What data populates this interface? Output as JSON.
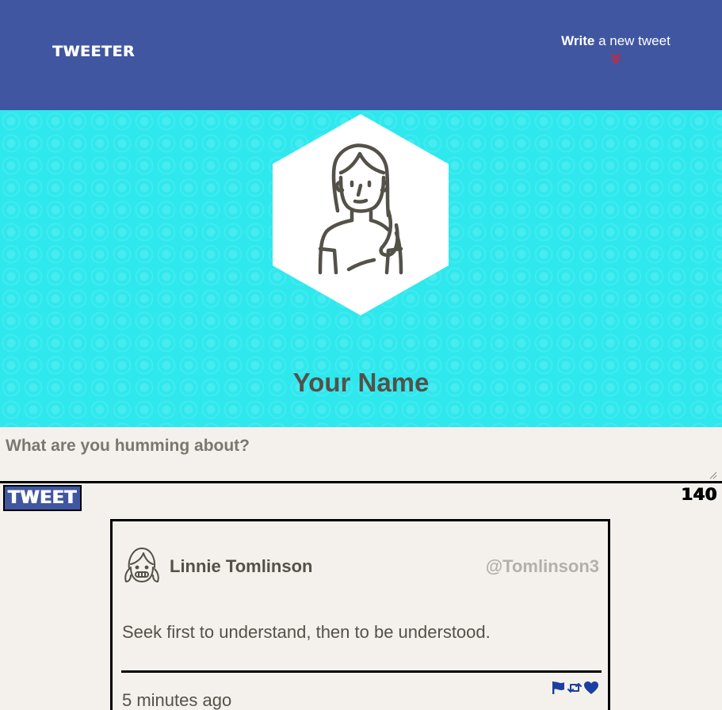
{
  "nav": {
    "brand": "TWEETER",
    "compose_bold": "Write",
    "compose_rest": " a new tweet",
    "arrow_icon": "double-chevron-down-icon",
    "arrow_color": "#e0212a"
  },
  "header": {
    "profile_name": "Your Name",
    "avatar_icon": "user-avatar-icon"
  },
  "composer": {
    "placeholder": "What are you humming about?",
    "value": "",
    "tweet_button": "TWEET",
    "counter": "140"
  },
  "tweets": [
    {
      "author": "Linnie Tomlinson",
      "handle": "@Tomlinson3",
      "text": "Seek first to understand, then to be understood.",
      "timestamp": "5 minutes ago",
      "actions": [
        "flag-icon",
        "retweet-icon",
        "heart-icon"
      ]
    }
  ],
  "colors": {
    "nav_bg": "#4056a1",
    "header_bg": "#2ee8ee",
    "page_bg": "#f4f1ec",
    "text": "#545149",
    "handle": "#b3b0aa",
    "action_icons": "#1b3fa0"
  }
}
